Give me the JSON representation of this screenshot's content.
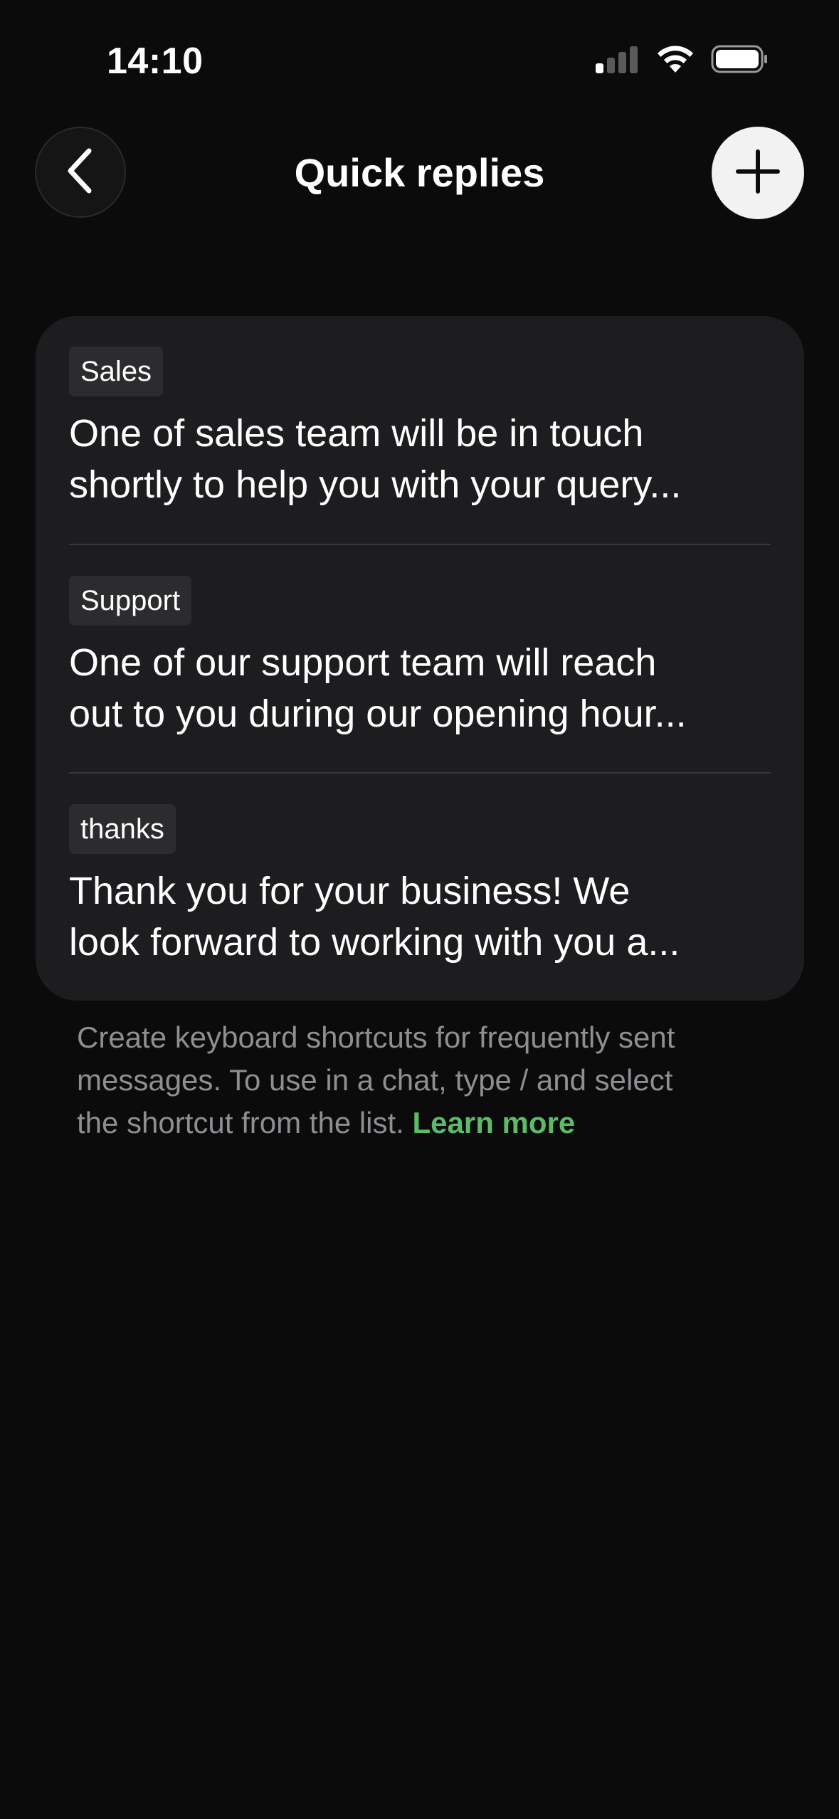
{
  "status_bar": {
    "time": "14:10",
    "icons": [
      "cellular-signal-icon",
      "wifi-icon",
      "battery-icon"
    ]
  },
  "nav": {
    "back_icon": "chevron-left-icon",
    "title": "Quick replies",
    "add_icon": "plus-icon"
  },
  "replies": [
    {
      "shortcut": "Sales",
      "message": "One of sales team will be in touch\nshortly to help you with your query..."
    },
    {
      "shortcut": "Support",
      "message": "One of our support team will reach\nout to you during our opening hour..."
    },
    {
      "shortcut": "thanks",
      "message": "Thank you for your business! We\nlook forward to working with you a..."
    }
  ],
  "footer": {
    "text": "Create keyboard shortcuts for frequently sent\nmessages. To use in a chat, type / and select\nthe shortcut from the list. ",
    "link_label": "Learn more"
  },
  "colors": {
    "background": "#0b0b0b",
    "card": "#1d1d1f",
    "tag": "#2c2c2e",
    "link": "#5bbb69",
    "secondary_text": "#8e8e93"
  }
}
